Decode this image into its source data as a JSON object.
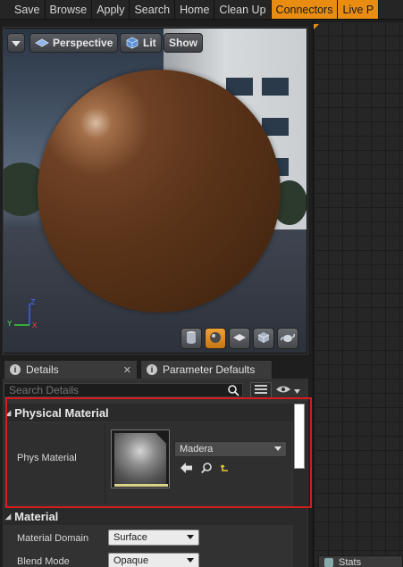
{
  "toolbar": {
    "buttons": [
      "Save",
      "Browse",
      "Apply",
      "Search",
      "Home",
      "Clean Up",
      "Connectors",
      "Live P"
    ]
  },
  "viewport": {
    "view_mode": "Perspective",
    "lit_label": "Lit",
    "show_label": "Show",
    "axis": {
      "x": "X",
      "y": "Y",
      "z": "Z"
    }
  },
  "details": {
    "tab_details": "Details",
    "tab_params": "Parameter Defaults",
    "search_placeholder": "Search Details",
    "physical_material_header": "Physical Material",
    "phys_material_label": "Phys Material",
    "phys_material_value": "Madera",
    "material_header": "Material",
    "material_domain_label": "Material Domain",
    "material_domain_value": "Surface",
    "blend_mode_label": "Blend Mode",
    "blend_mode_value": "Opaque"
  },
  "stats_tab": "Stats",
  "colors": {
    "accent": "#e88d12",
    "highlight": "#d81c1c",
    "sphere": "#5b3419"
  }
}
